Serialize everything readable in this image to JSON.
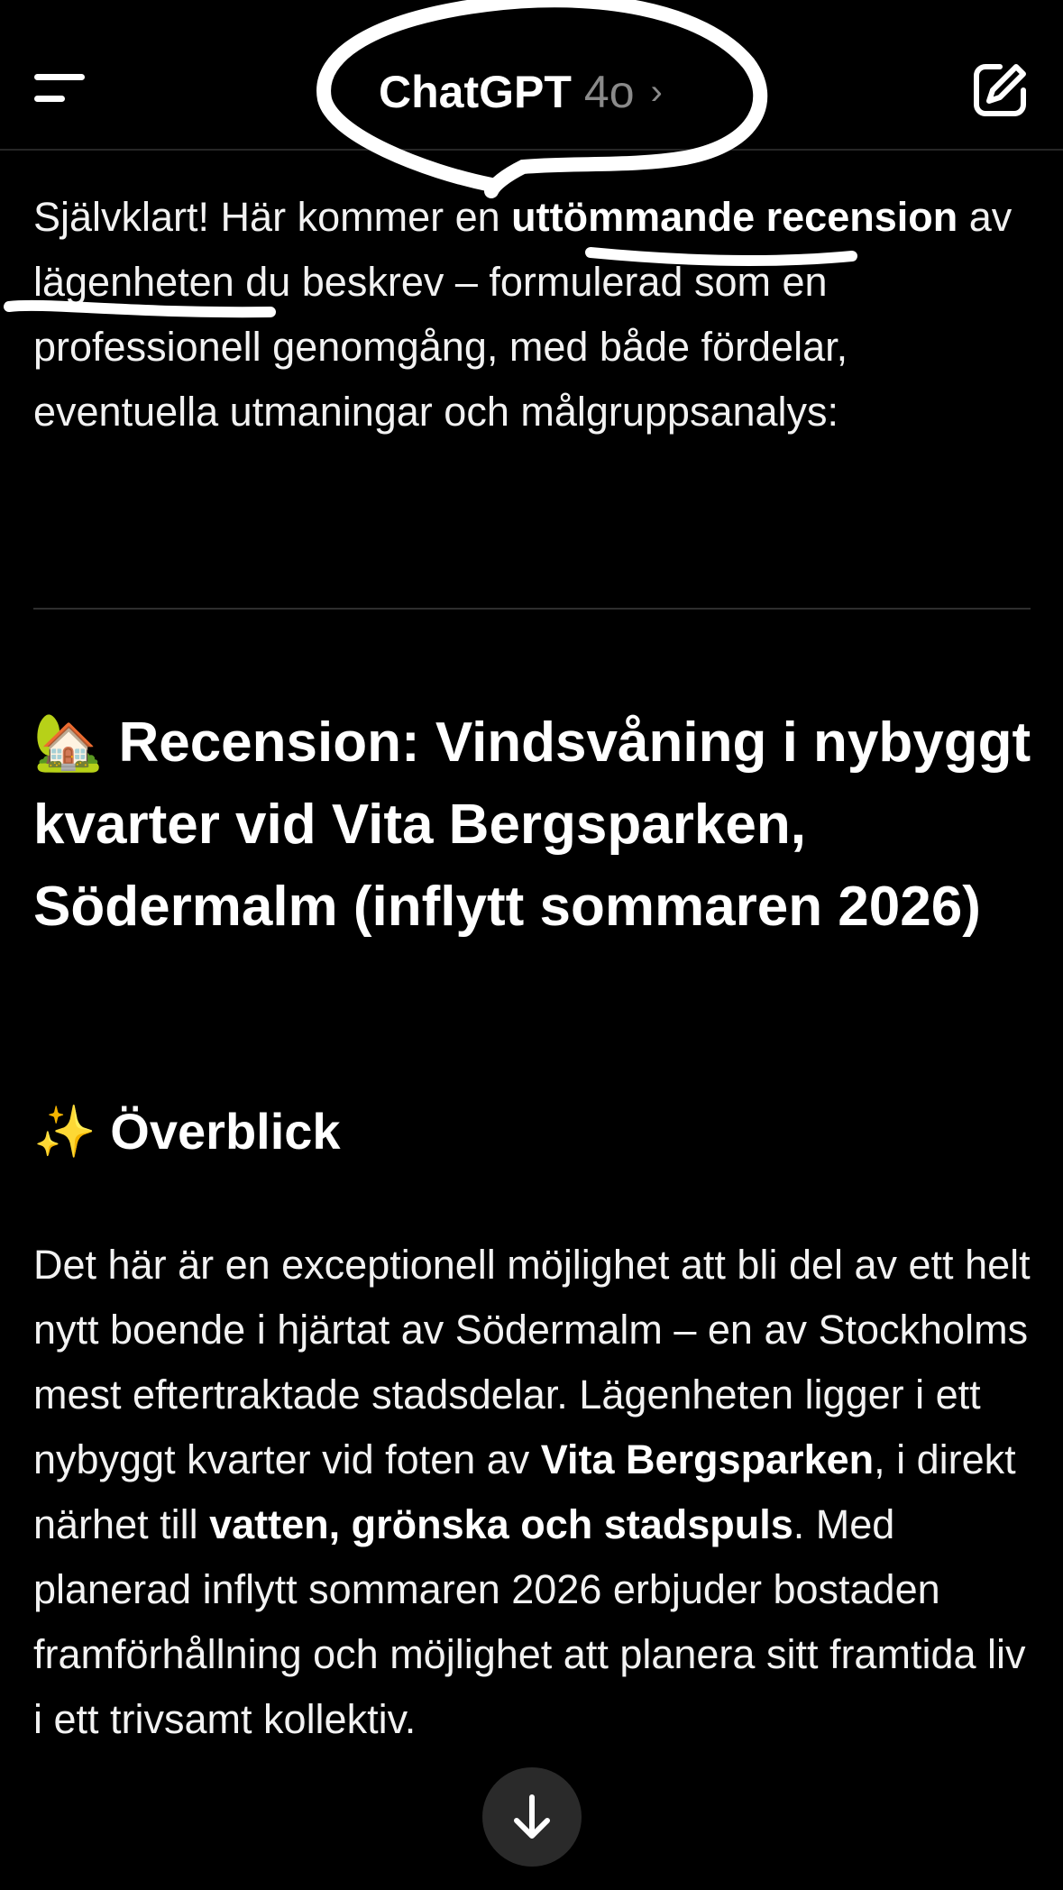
{
  "header": {
    "app_title": "ChatGPT",
    "model_label": "4o",
    "chevron": "›",
    "menu_icon": "menu-icon",
    "compose_icon": "compose-icon"
  },
  "message": {
    "intro_part1": "Självklart! Här kommer en ",
    "intro_bold": "uttömmande recension",
    "intro_part2": " av lägenheten du beskrev – formulerad som en professionell genomgång, med både fördelar, eventuella utmaningar och målgruppsanalys:",
    "heading_emoji": "🏡",
    "heading": "Recension: Vindsvåning i nybyggt kvarter vid Vita Bergsparken, Södermalm (inflytt sommaren 2026)",
    "section_emoji": "✨",
    "section_title": "Överblick",
    "para_part1": "Det här är en exceptionell möjlighet att bli del av ett helt nytt boende i hjärtat av Södermalm – en av Stockholms mest eftertraktade stadsdelar. Lägenheten ligger i ett nybyggt kvarter vid foten av ",
    "para_bold1": "Vita Bergsparken",
    "para_part2": ", i direkt närhet till ",
    "para_bold2": "vatten, grönska och stadspuls",
    "para_part3": ". Med planerad inflytt sommaren 2026 erbjuder bostaden framförhållning och möjlighet att planera sitt framtida liv i ett trivsamt kollektiv."
  },
  "scroll_button": {
    "icon": "arrow-down-icon"
  }
}
